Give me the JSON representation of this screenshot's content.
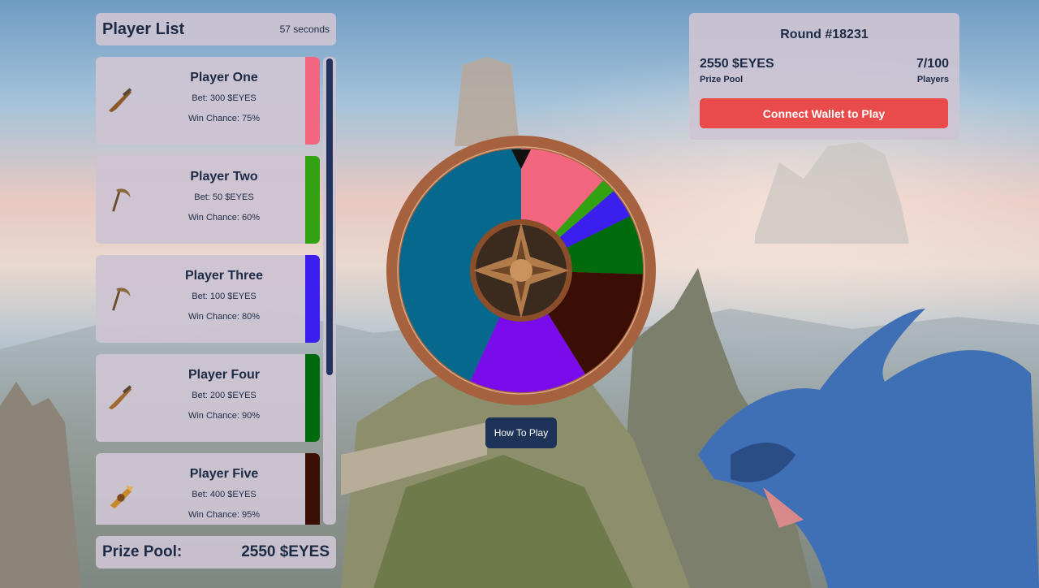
{
  "player_list": {
    "title": "Player List",
    "timer": "57 seconds",
    "players": [
      {
        "name": "Player One",
        "bet": "Bet: 300 $EYES",
        "chance": "Win Chance: 75%",
        "color": "#f2667f",
        "weapon_icon": "flintlock-icon"
      },
      {
        "name": "Player Two",
        "bet": "Bet: 50 $EYES",
        "chance": "Win Chance: 60%",
        "color": "#32a112",
        "weapon_icon": "scythe-icon"
      },
      {
        "name": "Player Three",
        "bet": "Bet: 100 $EYES",
        "chance": "Win Chance: 80%",
        "color": "#3a1fee",
        "weapon_icon": "scythe-icon"
      },
      {
        "name": "Player Four",
        "bet": "Bet: 200 $EYES",
        "chance": "Win Chance: 90%",
        "color": "#006b0d",
        "weapon_icon": "flintlock-icon"
      },
      {
        "name": "Player Five",
        "bet": "Bet: 400 $EYES",
        "chance": "Win Chance: 95%",
        "color": "#3a0e05",
        "weapon_icon": "blaster-icon"
      }
    ]
  },
  "prize_bar": {
    "label": "Prize Pool:",
    "value": "2550 $EYES"
  },
  "round": {
    "title": "Round #18231",
    "pool_value": "2550 $EYES",
    "pool_label": "Prize Pool",
    "players_value": "7/100",
    "players_label": "Players",
    "connect_label": "Connect Wallet to Play"
  },
  "how_to_play": "How To Play",
  "wheel": {
    "segments": [
      {
        "color": "#f2667f",
        "share": 300
      },
      {
        "color": "#32a112",
        "share": 50
      },
      {
        "color": "#3a1fee",
        "share": 100
      },
      {
        "color": "#006b0d",
        "share": 200
      },
      {
        "color": "#3a0e05",
        "share": 400
      },
      {
        "color": "#7a0bea",
        "share": 400
      },
      {
        "color": "#05688c",
        "share": 1100
      }
    ],
    "pointer_color": "#111111",
    "rim_color": "#a6623f"
  }
}
